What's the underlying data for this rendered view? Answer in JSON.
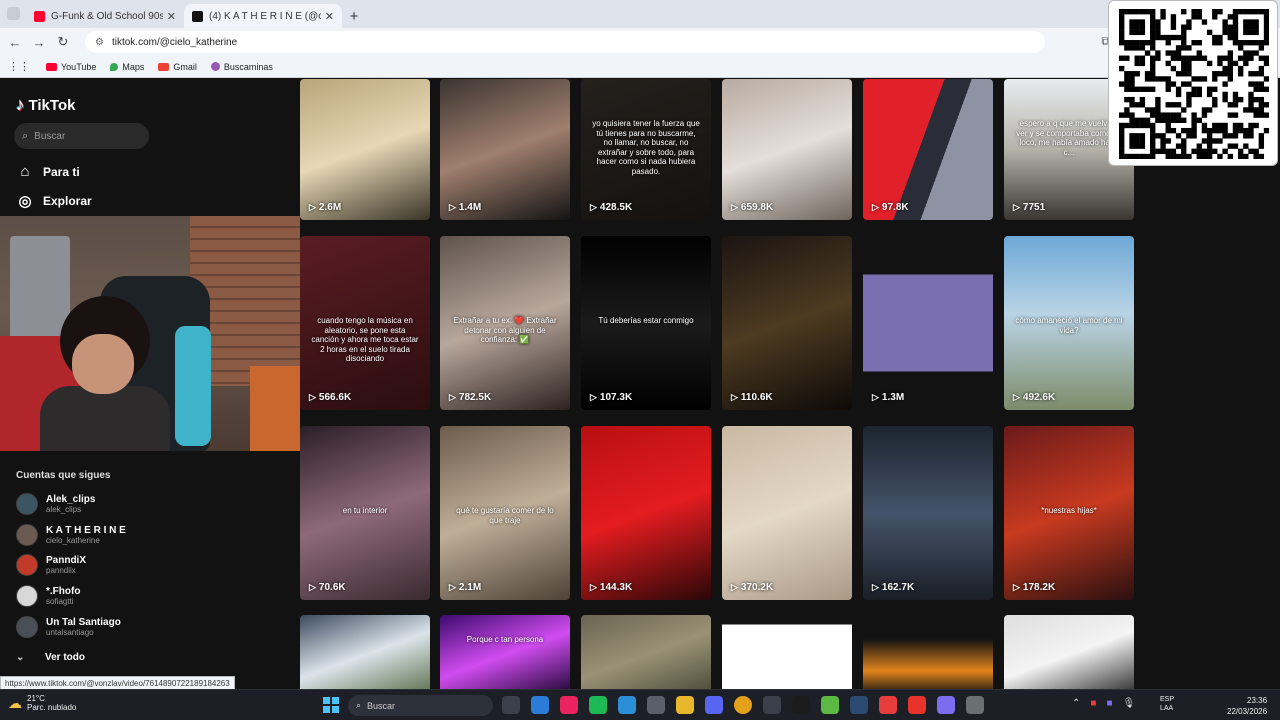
{
  "tabs": [
    {
      "title": "G-Funk & Old School 90s 💥 Sn",
      "favicon_color": "#ff0033",
      "active": false
    },
    {
      "title": "(4) K A T H E R I N E (@cielo_kat",
      "favicon_color": "#111111",
      "active": true
    }
  ],
  "address": {
    "url": "tiktok.com/@cielo_katherine"
  },
  "bookmarks": [
    {
      "label": "YouTube",
      "color": "#ff0033"
    },
    {
      "label": "Maps",
      "color": "#34a853"
    },
    {
      "label": "Gmail",
      "color": "#ea4335"
    },
    {
      "label": "Buscaminas",
      "color": "#9b59b6"
    }
  ],
  "tiktok": {
    "logo": "TikTok",
    "search_placeholder": "Buscar",
    "nav": [
      {
        "label": "Para ti",
        "icon": "home-icon"
      },
      {
        "label": "Explorar",
        "icon": "compass-icon"
      }
    ],
    "following_title": "Cuentas que sigues",
    "following": [
      {
        "name": "Alek_clips",
        "handle": "alek_clips",
        "color": "#3b5563"
      },
      {
        "name": "K A T H E R I N E",
        "handle": "cielo_katherine",
        "color": "#6b5a50"
      },
      {
        "name": "PanndiX",
        "handle": "panndiix",
        "color": "#c23a2a"
      },
      {
        "name": "*.Fhofo",
        "handle": "sofiagtti",
        "color": "#d8d8d8"
      },
      {
        "name": "Un Tal Santiago",
        "handle": "untalsantiago",
        "color": "#4a4f55"
      }
    ],
    "see_all": "Ver todo"
  },
  "status_url": "https://www.tiktok.com/@vonzlav/video/7614890722189184263",
  "videos": [
    {
      "views": "2.6M",
      "bg": "linear-gradient(160deg,#b9a57a,#e7d7b5 50%,#3a3528)",
      "text": ""
    },
    {
      "views": "1.4M",
      "bg": "linear-gradient(160deg,#3b3431,#a07f6e 50%,#141414)",
      "text": ""
    },
    {
      "views": "428.5K",
      "bg": "linear-gradient(160deg,#24201c,#141210)",
      "text": "yo quisiera tener la fuerza que tú tienes para no buscarme, no llamar, no buscar, no extrañar y sobre todo, para hacer como si nada hubiera pasado."
    },
    {
      "views": "659.8K",
      "bg": "linear-gradient(160deg,#b8aaa0,#e4dfda 50%,#6e645c)",
      "text": ""
    },
    {
      "views": "97.8K",
      "bg": "linear-gradient(110deg,#e2202a 0 45%,#2a2d38 45% 60%,#8d93a3 60%)",
      "text": ""
    },
    {
      "views": "7751",
      "bg": "linear-gradient(180deg,#e8ecef,#b5b2aa 50%,#3a3632)",
      "text": "espero a q que me vuelva a ver y se comportaba como un loco, me había amado hace c..."
    },
    {
      "views": "566.6K",
      "bg": "linear-gradient(160deg,#5a1d22,#2b0d10)",
      "text": "cuando tengo la música en aleatorio, se pone esta canción y ahora me toca estar 2 horas en el suelo tirada disociando"
    },
    {
      "views": "782.5K",
      "bg": "linear-gradient(160deg,#5f534c,#b8a79b 50%,#2c2220)",
      "text": "Extrañar a tu ex: ❤️ Extrañar detonar con alguien de confianza: ✅"
    },
    {
      "views": "107.3K",
      "bg": "linear-gradient(180deg,#000000,#1b1b1b 50%,#000000)",
      "text": "Tú deberías estar conmigo"
    },
    {
      "views": "110.6K",
      "bg": "linear-gradient(160deg,#1b1412,#4d3b21 50%,#0e0a08)",
      "text": ""
    },
    {
      "views": "1.3M",
      "bg": "linear-gradient(180deg,#121212 0 22%,#7a6fb0 22% 78%,#121212 78%)",
      "text": ""
    },
    {
      "views": "492.6K",
      "bg": "linear-gradient(180deg,#6ea8d6,#b9d4e6 45%,#7d8c6a)",
      "text": "cómo amaneció el amor de mi vida?"
    },
    {
      "views": "70.6K",
      "bg": "linear-gradient(160deg,#2b1e26,#8e6a78 50%,#3a2a30)",
      "text": "en tu interior"
    },
    {
      "views": "2.1M",
      "bg": "linear-gradient(160deg,#6d5b4c,#bfae98 50%,#4e4237)",
      "text": "qué te gustaría comer de lo que traje"
    },
    {
      "views": "144.3K",
      "bg": "linear-gradient(160deg,#b80f12,#e41c20 50%,#2a0708)",
      "text": ""
    },
    {
      "views": "370.2K",
      "bg": "linear-gradient(160deg,#c9b9a3,#e4d8c6 50%,#a99a86)",
      "text": ""
    },
    {
      "views": "162.7K",
      "bg": "linear-gradient(180deg,#1c2530,#45546a 50%,#1a1f27)",
      "text": ""
    },
    {
      "views": "178.2K",
      "bg": "linear-gradient(160deg,#6b1a1a,#c83a20 50%,#2a1010)",
      "text": "*nuestras hijas*"
    },
    {
      "views": "",
      "bg": "linear-gradient(160deg,#3b4a5e,#dce4ea 50%,#5a6e4b)",
      "text": ""
    },
    {
      "views": "",
      "bg": "linear-gradient(160deg,#3c0b6e,#d14cf0 50%,#1a0630)",
      "text": "Porque c tan persona"
    },
    {
      "views": "",
      "bg": "linear-gradient(160deg,#6a6350,#9a9276 50%,#4a4a38)",
      "text": ""
    },
    {
      "views": "",
      "bg": "linear-gradient(180deg,#121212 0 12%,#ffffff 12%)",
      "text": ""
    },
    {
      "views": "",
      "bg": "linear-gradient(180deg,#121212 0 30%,#e0841c 70%,#121212)",
      "text": ""
    },
    {
      "views": "",
      "bg": "linear-gradient(160deg,#dedede,#f4f4f4 50%,#2a2a2a)",
      "text": ""
    }
  ],
  "taskbar": {
    "temperature": "21°C",
    "weather": "Parc. nublado",
    "search_placeholder": "Buscar",
    "apps": [
      "#3a3f4a",
      "#2b7bd8",
      "#e8235f",
      "#1db954",
      "#2b8fd8",
      "#5b5f6a",
      "#e8b72b",
      "#5865f2",
      "#e3a21a",
      "#3a3f4a",
      "#1b1b1b",
      "#5bb944",
      "#2a4a72",
      "#e83b3b",
      "#e8332a",
      "#7b6cf0",
      "#6a6f72"
    ],
    "lang_top": "ESP",
    "lang_bottom": "LAA",
    "time": "23:36",
    "date": "22/03/2026"
  }
}
